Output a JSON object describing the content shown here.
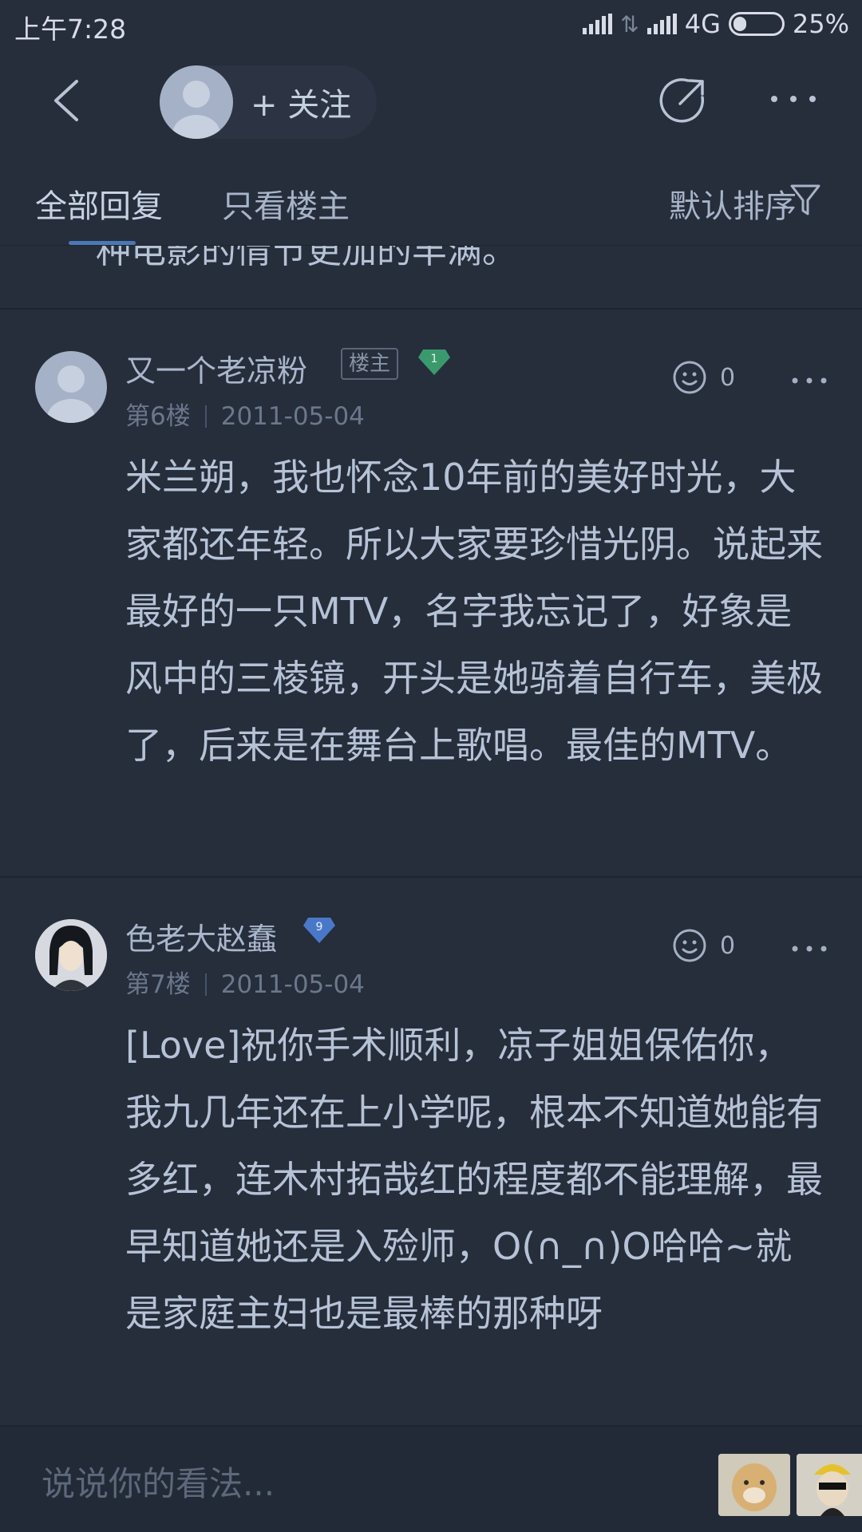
{
  "status_bar": {
    "time": "上午7:28",
    "network": "4G",
    "battery": "25%"
  },
  "header": {
    "follow_label": "+ 关注"
  },
  "tabs": {
    "all_replies": "全部回复",
    "owner_only": "只看楼主",
    "sort_label": "默认排序"
  },
  "clipped_text": "种电影的情节更加的丰满。",
  "posts": [
    {
      "username": "又一个老凉粉",
      "owner_tag": "楼主",
      "level": "1",
      "floor": "第6楼",
      "date": "2011-05-04",
      "likes": "0",
      "content": "米兰朔，我也怀念10年前的美好时光，大家都还年轻。所以大家要珍惜光阴。说起来最好的一只MTV，名字我忘记了，好象是风中的三棱镜，开头是她骑着自行车，美极了，后来是在舞台上歌唱。最佳的MTV。"
    },
    {
      "username": "色老大赵蠢",
      "level": "9",
      "floor": "第7楼",
      "date": "2011-05-04",
      "likes": "0",
      "content": "[Love]祝你手术顺利，凉子姐姐保佑你，我九几年还在上小学呢，根本不知道她能有多红，连木村拓哉红的程度都不能理解，最早知道她还是入殓师，O(∩_∩)O哈哈~就是家庭主妇也是最棒的那种呀"
    }
  ],
  "input_bar": {
    "placeholder": "说说你的看法..."
  },
  "colors": {
    "background": "#262d3b",
    "accent": "#4a78b4",
    "level1_badge": "#3a9a6e",
    "level9_badge": "#4a78c8"
  }
}
